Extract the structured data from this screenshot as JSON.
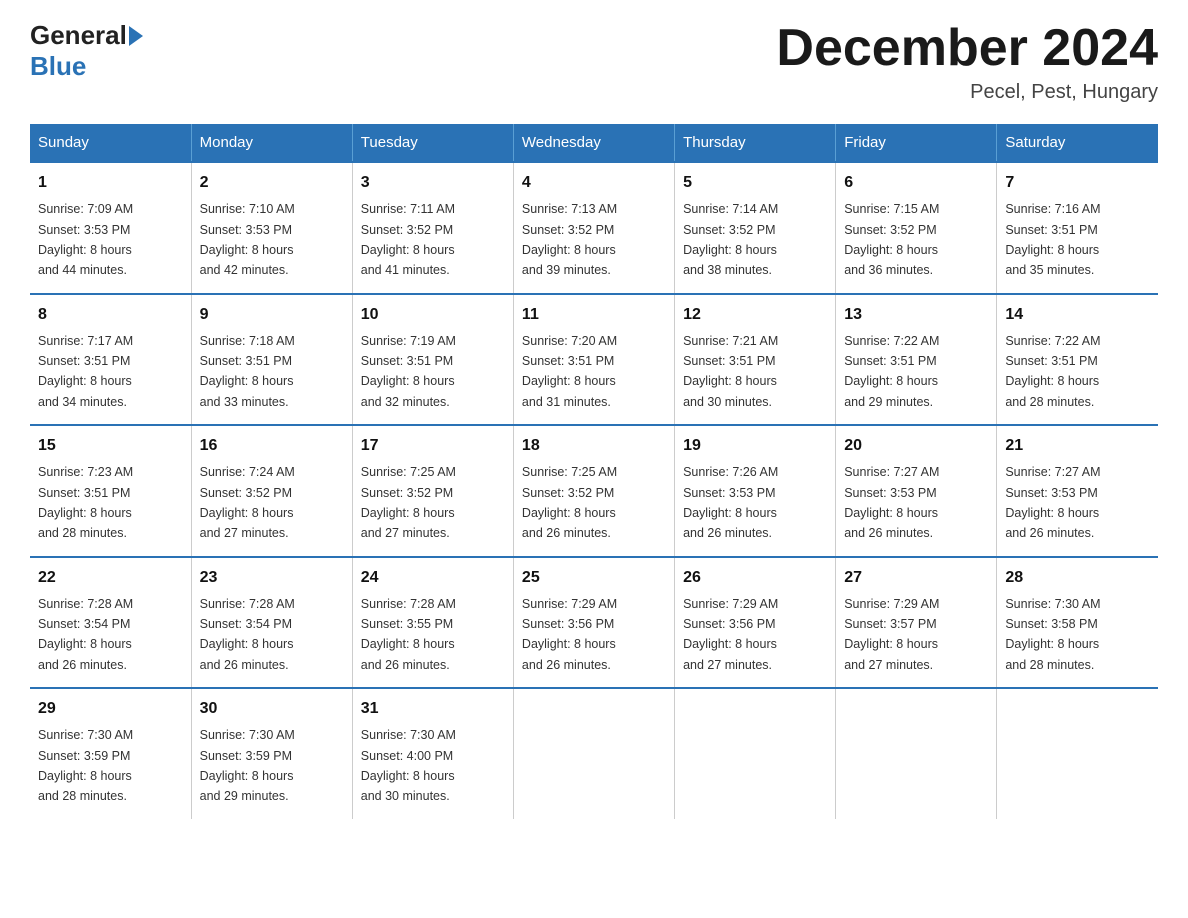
{
  "header": {
    "month_title": "December 2024",
    "location": "Pecel, Pest, Hungary",
    "logo_general": "General",
    "logo_blue": "Blue"
  },
  "days_of_week": [
    "Sunday",
    "Monday",
    "Tuesday",
    "Wednesday",
    "Thursday",
    "Friday",
    "Saturday"
  ],
  "weeks": [
    [
      {
        "day": "1",
        "sunrise": "7:09 AM",
        "sunset": "3:53 PM",
        "daylight": "8 hours and 44 minutes."
      },
      {
        "day": "2",
        "sunrise": "7:10 AM",
        "sunset": "3:53 PM",
        "daylight": "8 hours and 42 minutes."
      },
      {
        "day": "3",
        "sunrise": "7:11 AM",
        "sunset": "3:52 PM",
        "daylight": "8 hours and 41 minutes."
      },
      {
        "day": "4",
        "sunrise": "7:13 AM",
        "sunset": "3:52 PM",
        "daylight": "8 hours and 39 minutes."
      },
      {
        "day": "5",
        "sunrise": "7:14 AM",
        "sunset": "3:52 PM",
        "daylight": "8 hours and 38 minutes."
      },
      {
        "day": "6",
        "sunrise": "7:15 AM",
        "sunset": "3:52 PM",
        "daylight": "8 hours and 36 minutes."
      },
      {
        "day": "7",
        "sunrise": "7:16 AM",
        "sunset": "3:51 PM",
        "daylight": "8 hours and 35 minutes."
      }
    ],
    [
      {
        "day": "8",
        "sunrise": "7:17 AM",
        "sunset": "3:51 PM",
        "daylight": "8 hours and 34 minutes."
      },
      {
        "day": "9",
        "sunrise": "7:18 AM",
        "sunset": "3:51 PM",
        "daylight": "8 hours and 33 minutes."
      },
      {
        "day": "10",
        "sunrise": "7:19 AM",
        "sunset": "3:51 PM",
        "daylight": "8 hours and 32 minutes."
      },
      {
        "day": "11",
        "sunrise": "7:20 AM",
        "sunset": "3:51 PM",
        "daylight": "8 hours and 31 minutes."
      },
      {
        "day": "12",
        "sunrise": "7:21 AM",
        "sunset": "3:51 PM",
        "daylight": "8 hours and 30 minutes."
      },
      {
        "day": "13",
        "sunrise": "7:22 AM",
        "sunset": "3:51 PM",
        "daylight": "8 hours and 29 minutes."
      },
      {
        "day": "14",
        "sunrise": "7:22 AM",
        "sunset": "3:51 PM",
        "daylight": "8 hours and 28 minutes."
      }
    ],
    [
      {
        "day": "15",
        "sunrise": "7:23 AM",
        "sunset": "3:51 PM",
        "daylight": "8 hours and 28 minutes."
      },
      {
        "day": "16",
        "sunrise": "7:24 AM",
        "sunset": "3:52 PM",
        "daylight": "8 hours and 27 minutes."
      },
      {
        "day": "17",
        "sunrise": "7:25 AM",
        "sunset": "3:52 PM",
        "daylight": "8 hours and 27 minutes."
      },
      {
        "day": "18",
        "sunrise": "7:25 AM",
        "sunset": "3:52 PM",
        "daylight": "8 hours and 26 minutes."
      },
      {
        "day": "19",
        "sunrise": "7:26 AM",
        "sunset": "3:53 PM",
        "daylight": "8 hours and 26 minutes."
      },
      {
        "day": "20",
        "sunrise": "7:27 AM",
        "sunset": "3:53 PM",
        "daylight": "8 hours and 26 minutes."
      },
      {
        "day": "21",
        "sunrise": "7:27 AM",
        "sunset": "3:53 PM",
        "daylight": "8 hours and 26 minutes."
      }
    ],
    [
      {
        "day": "22",
        "sunrise": "7:28 AM",
        "sunset": "3:54 PM",
        "daylight": "8 hours and 26 minutes."
      },
      {
        "day": "23",
        "sunrise": "7:28 AM",
        "sunset": "3:54 PM",
        "daylight": "8 hours and 26 minutes."
      },
      {
        "day": "24",
        "sunrise": "7:28 AM",
        "sunset": "3:55 PM",
        "daylight": "8 hours and 26 minutes."
      },
      {
        "day": "25",
        "sunrise": "7:29 AM",
        "sunset": "3:56 PM",
        "daylight": "8 hours and 26 minutes."
      },
      {
        "day": "26",
        "sunrise": "7:29 AM",
        "sunset": "3:56 PM",
        "daylight": "8 hours and 27 minutes."
      },
      {
        "day": "27",
        "sunrise": "7:29 AM",
        "sunset": "3:57 PM",
        "daylight": "8 hours and 27 minutes."
      },
      {
        "day": "28",
        "sunrise": "7:30 AM",
        "sunset": "3:58 PM",
        "daylight": "8 hours and 28 minutes."
      }
    ],
    [
      {
        "day": "29",
        "sunrise": "7:30 AM",
        "sunset": "3:59 PM",
        "daylight": "8 hours and 28 minutes."
      },
      {
        "day": "30",
        "sunrise": "7:30 AM",
        "sunset": "3:59 PM",
        "daylight": "8 hours and 29 minutes."
      },
      {
        "day": "31",
        "sunrise": "7:30 AM",
        "sunset": "4:00 PM",
        "daylight": "8 hours and 30 minutes."
      },
      {
        "day": "",
        "sunrise": "",
        "sunset": "",
        "daylight": ""
      },
      {
        "day": "",
        "sunrise": "",
        "sunset": "",
        "daylight": ""
      },
      {
        "day": "",
        "sunrise": "",
        "sunset": "",
        "daylight": ""
      },
      {
        "day": "",
        "sunrise": "",
        "sunset": "",
        "daylight": ""
      }
    ]
  ],
  "labels": {
    "sunrise": "Sunrise:",
    "sunset": "Sunset:",
    "daylight": "Daylight:"
  }
}
